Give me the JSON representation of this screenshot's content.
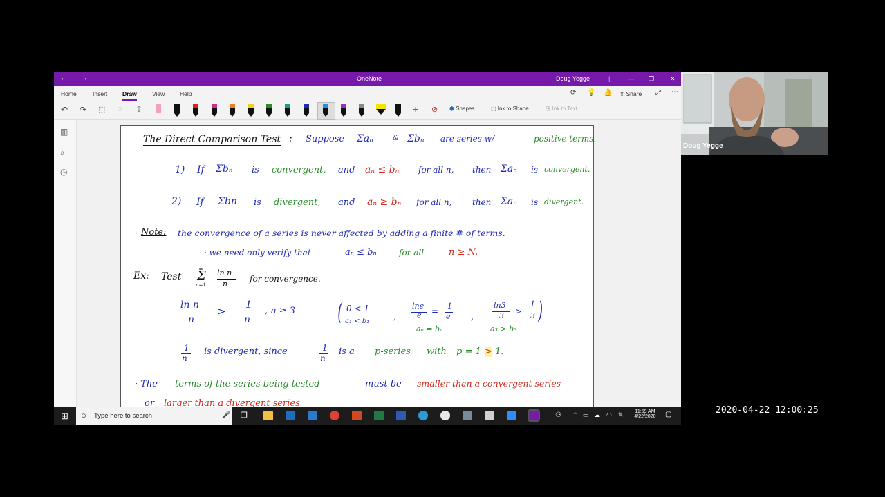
{
  "window": {
    "title": "OneNote",
    "user": "Doug Yegge",
    "tabs": [
      "Home",
      "Insert",
      "Draw",
      "View",
      "Help"
    ],
    "active_tab": "Draw",
    "share_label": "Share",
    "tools": {
      "shapes": "Shapes",
      "ink_to_shape": "Ink to Shape",
      "ink_to_text": "Ink to Text"
    }
  },
  "note": {
    "title": "The Direct Comparison Test",
    "suppose": "Suppose",
    "sum_an": "Σaₙ",
    "amp": "&",
    "sum_bn": "Σbₙ",
    "are_series_w": "are series w/",
    "positive_terms": "positive terms.",
    "case1": {
      "num": "1)",
      "if": "If",
      "sum_bn": "Σbₙ",
      "is": "is",
      "convergent": "convergent,",
      "and": "and",
      "ineq": "aₙ ≤ bₙ",
      "for_all": "for all n,",
      "then": "then",
      "sum_an": "Σaₙ",
      "is2": "is",
      "result": "convergent."
    },
    "case2": {
      "num": "2)",
      "if": "If",
      "sum_bn": "Σbn",
      "is": "is",
      "divergent": "divergent,",
      "and": "and",
      "ineq": "aₙ ≥ bₙ",
      "for_all": "for all n,",
      "then": "then",
      "sum_an": "Σaₙ",
      "is2": "is",
      "result": "divergent."
    },
    "note_label": "Note:",
    "note_text": "the convergence of a series is never affected by adding a finite # of terms.",
    "verify_prefix": "· we need only verify that",
    "verify_ineq": "aₙ ≤ bₙ",
    "verify_for_all": "for all",
    "verify_cond": "n ≥ N.",
    "ex_label": "Ex:",
    "ex_test": "Test",
    "ex_sum": "Σ",
    "ex_top": "∞",
    "ex_bottom": "n=1",
    "ex_frac_num": "ln n",
    "ex_frac_den": "n",
    "ex_for": "for convergence.",
    "cmp_lhs_num": "ln n",
    "cmp_lhs_den": "n",
    "cmp_gt": ">",
    "cmp_rhs_num": "1",
    "cmp_rhs_den": "n",
    "cmp_cond": ", n ≥ 3",
    "aside_1_top": "0 < 1",
    "aside_1_bot": "a₁ < b₁",
    "aside_2_lhs_num": "lne",
    "aside_2_lhs_den": "e",
    "aside_2_eq": "=",
    "aside_2_rhs_num": "1",
    "aside_2_rhs_den": "e",
    "aside_2_bot": "aₑ = bₑ",
    "aside_3_lhs_num": "ln3",
    "aside_3_lhs_den": "3",
    "aside_3_gt": ">",
    "aside_3_rhs_num": "1",
    "aside_3_rhs_den": "3",
    "aside_3_bot": "a₃ > b₃",
    "div_num": "1",
    "div_den": "n",
    "div_text": "is divergent, since",
    "div_num2": "1",
    "div_den2": "n",
    "div_is_a": "is a",
    "div_pseries": "p-series",
    "div_with": "with",
    "div_p": "p = 1",
    "div_gt": ">",
    "div_end": "1.",
    "bullet1_a": "· The",
    "bullet1_b": "terms of the series being tested",
    "bullet1_c": "must be",
    "bullet1_d": "smaller than a convergent series",
    "bullet2_a": "or",
    "bullet2_b": "larger than a divergent series"
  },
  "webcam": {
    "name": "Doug Yegge"
  },
  "taskbar": {
    "search_placeholder": "Type here to search",
    "time": "11:59 AM",
    "date": "4/22/2020"
  },
  "timestamp": "2020-04-22  12:00:25",
  "colors": {
    "titlebar": "#7719aa",
    "blue_ink": "#1f2bb5",
    "green_ink": "#2a8a2a",
    "red_ink": "#d22a1e"
  }
}
